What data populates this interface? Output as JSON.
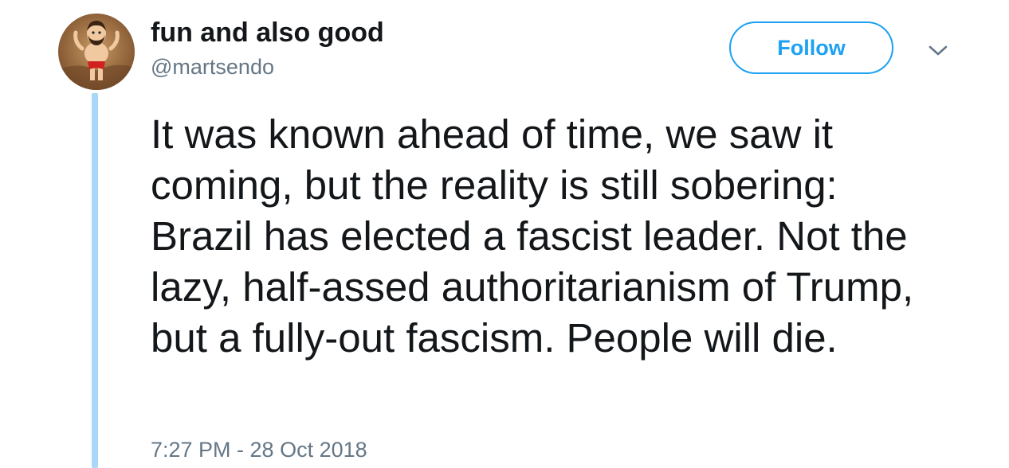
{
  "tweet": {
    "author": {
      "display_name": "fun and also good",
      "handle": "@martsendo",
      "avatar_icon": "cartoon-figure-avatar"
    },
    "follow_label": "Follow",
    "menu_icon": "chevron-down-icon",
    "text": "It was known ahead of time, we saw it coming, but the reality is still sobering: Brazil has elected a fascist leader. Not the lazy, half-assed authoritarianism of Trump, but a fully-out fascism. People will die.",
    "timestamp": "7:27 PM - 28 Oct 2018"
  },
  "colors": {
    "accent": "#1da1f2",
    "thread_line": "#a8d8f8",
    "text_primary": "#14171a",
    "text_secondary": "#657786"
  }
}
